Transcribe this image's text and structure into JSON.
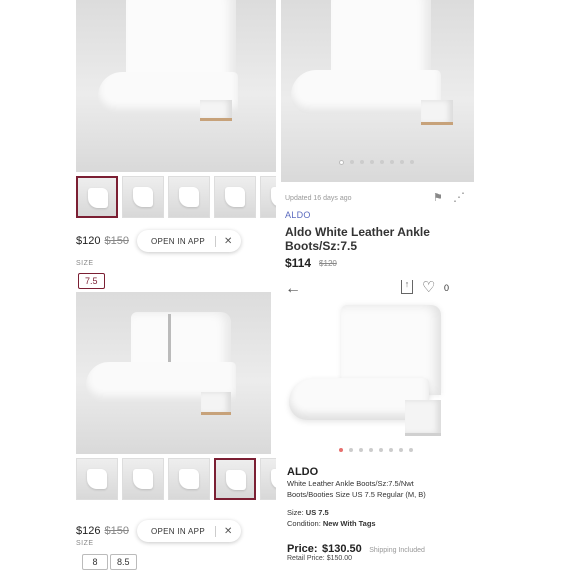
{
  "panel_tl": {
    "price": "$120",
    "original_price": "$150",
    "open_app_label": "OPEN IN APP",
    "size_label": "SIZE",
    "size_selected": "7.5"
  },
  "panel_bl": {
    "price": "$126",
    "original_price": "$150",
    "open_app_label": "OPEN IN APP",
    "size_label": "SIZE",
    "sizes": [
      "8",
      "8.5"
    ]
  },
  "panel_tr": {
    "updated": "Updated 16 days ago",
    "brand": "ALDO",
    "title_line1": "Aldo White Leather Ankle",
    "title_line2": "Boots/Sz:7.5",
    "price": "$114",
    "original_price": "$120",
    "like_count": "0",
    "carousel_dots": 8,
    "carousel_active": 0
  },
  "panel_br": {
    "brand": "ALDO",
    "desc_line1": "White Leather Ankle Boots/Sz:7.5/Nwt",
    "desc_line2": "Boots/Booties Size US 7.5 Regular (M, B)",
    "size_label": "Size:",
    "size_value": "US 7.5",
    "condition_label": "Condition:",
    "condition_value": "New With Tags",
    "price_label": "Price:",
    "price_value": "$130.50",
    "shipping": "Shipping Included",
    "retail_label": "Retail Price:",
    "retail_value": "$150.00",
    "carousel_dots": 8,
    "carousel_active": 0
  },
  "colors": {
    "accent_maroon": "#7b1f33",
    "brand_blue": "#5b6bbf",
    "dot_red": "#e7706e"
  }
}
